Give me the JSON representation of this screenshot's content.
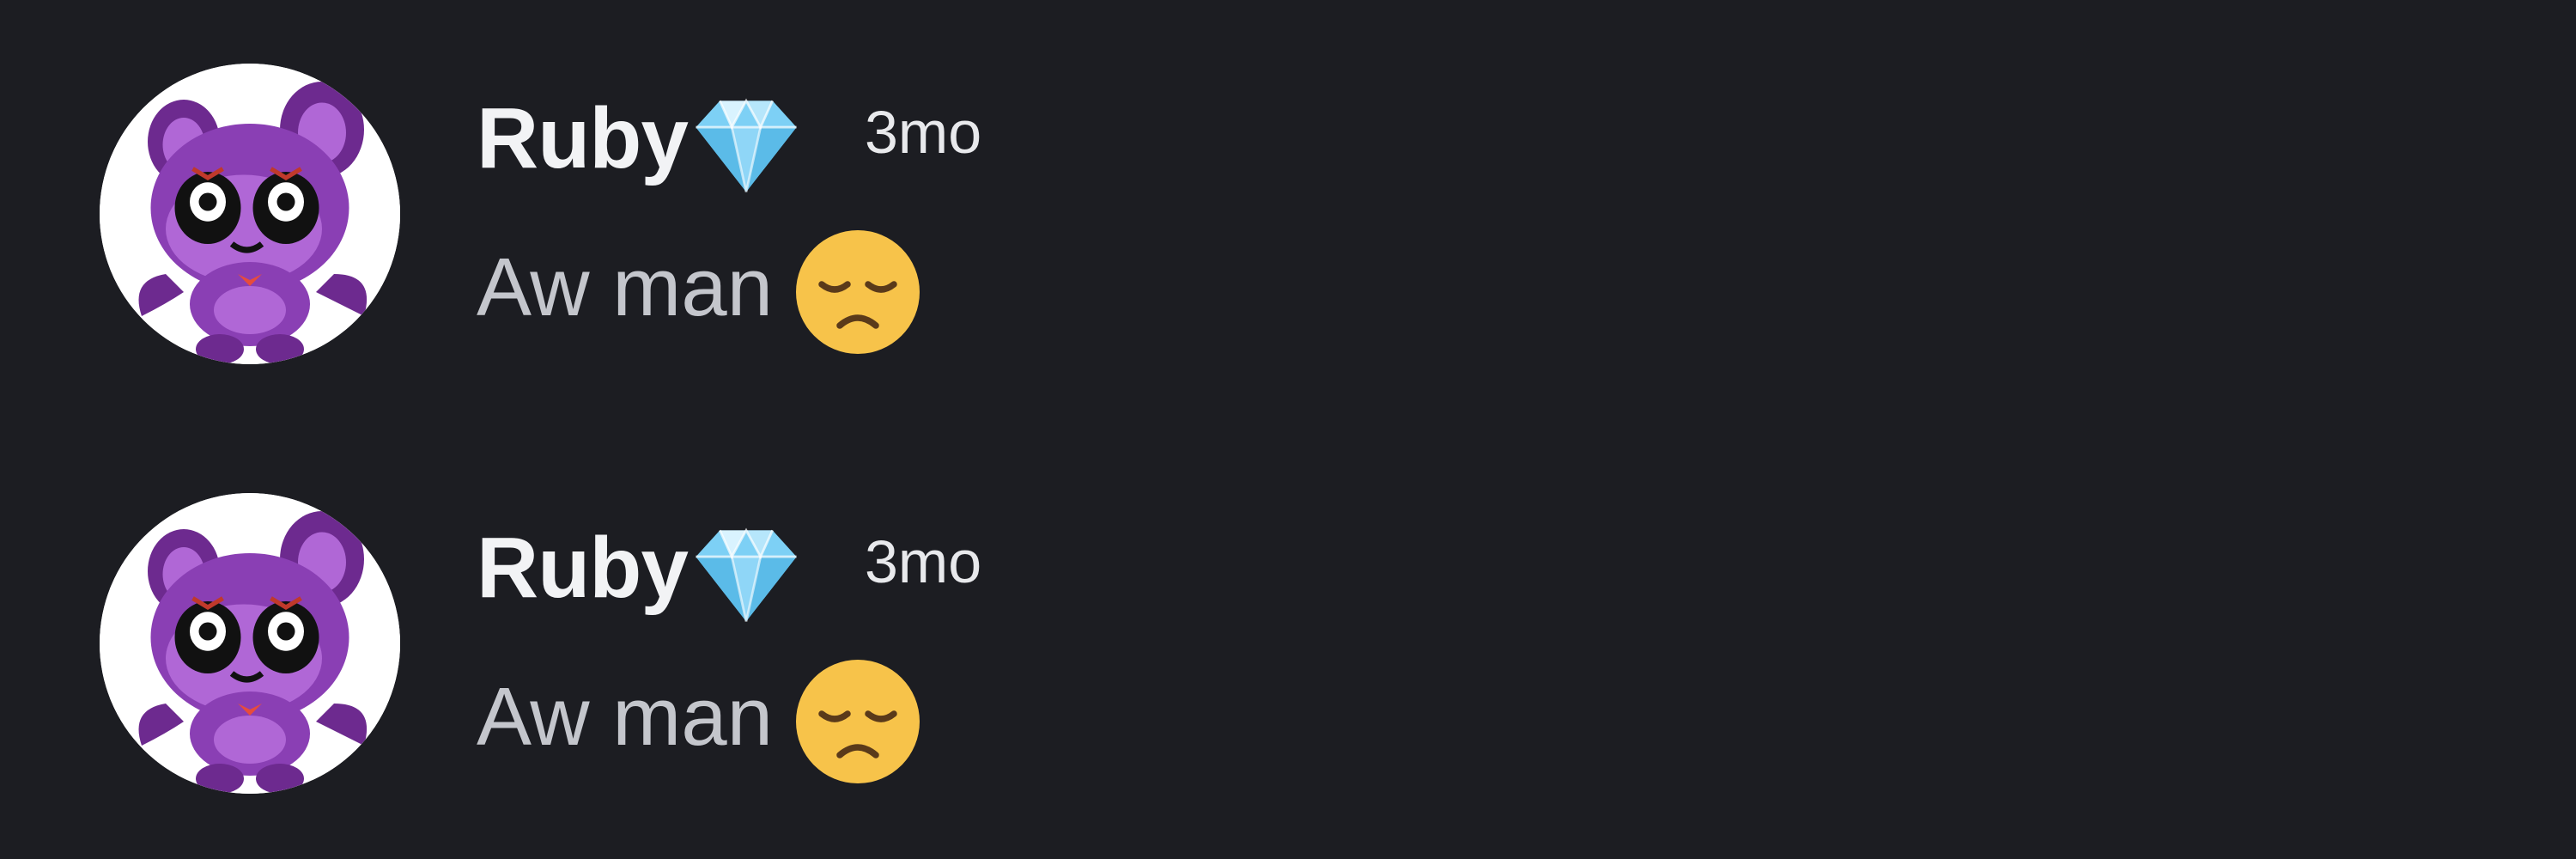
{
  "messages": [
    {
      "author": "Ruby",
      "author_badge_icon": "gem-stone-icon",
      "timestamp": "3mo",
      "text": "Aw man",
      "emoji_icon": "disappointed-face-icon",
      "avatar_icon": "purple-cartoon-creature-avatar"
    },
    {
      "author": "Ruby",
      "author_badge_icon": "gem-stone-icon",
      "timestamp": "3mo",
      "text": "Aw man",
      "emoji_icon": "disappointed-face-icon",
      "avatar_icon": "purple-cartoon-creature-avatar"
    }
  ],
  "colors": {
    "background": "#1c1d22",
    "author": "#f2f3f5",
    "timestamp": "#e8e9ec",
    "body_text": "#c4c6cc",
    "avatar_purple": "#8a3fb4",
    "gem": "#7dd0f5",
    "emoji_face": "#f7c34a"
  }
}
